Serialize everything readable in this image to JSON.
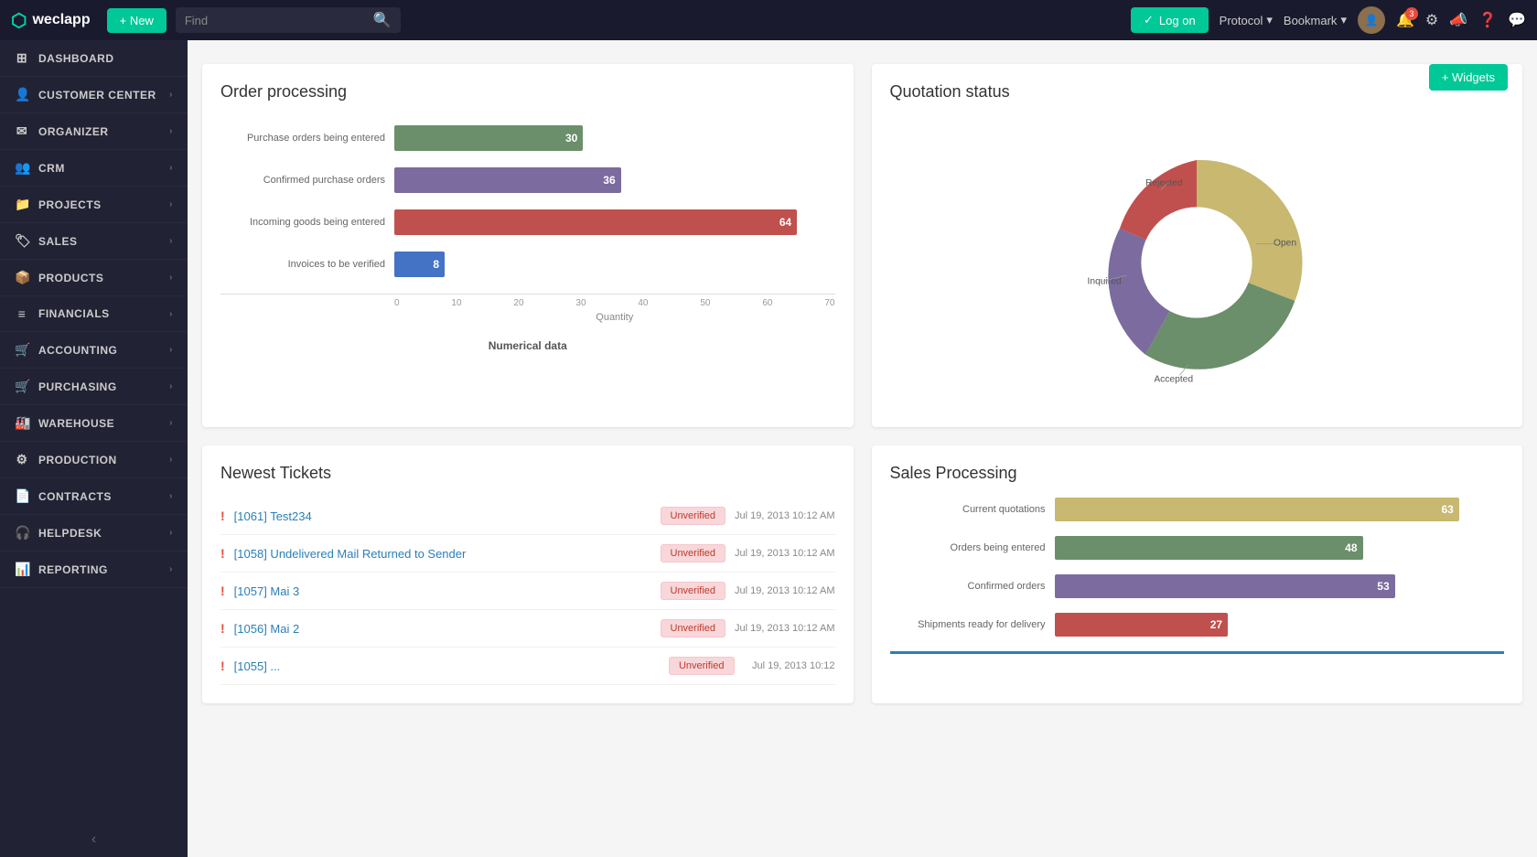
{
  "navbar": {
    "logo_text": "weclapp",
    "new_button": "+ New",
    "search_placeholder": "Find",
    "logon_button": "Log on",
    "protocol_label": "Protocol",
    "bookmark_label": "Bookmark",
    "notification_badge": "3"
  },
  "sidebar": {
    "items": [
      {
        "id": "dashboard",
        "label": "Dashboard",
        "icon": "⊞"
      },
      {
        "id": "customer-center",
        "label": "Customer Center",
        "icon": "👤"
      },
      {
        "id": "organizer",
        "label": "Organizer",
        "icon": "✉"
      },
      {
        "id": "crm",
        "label": "CRM",
        "icon": "👥"
      },
      {
        "id": "projects",
        "label": "Projects",
        "icon": "📁"
      },
      {
        "id": "sales",
        "label": "Sales",
        "icon": "🏷"
      },
      {
        "id": "products",
        "label": "Products",
        "icon": "📦"
      },
      {
        "id": "financials",
        "label": "Financials",
        "icon": "≡"
      },
      {
        "id": "accounting",
        "label": "Accounting",
        "icon": "🛒"
      },
      {
        "id": "purchasing",
        "label": "Purchasing",
        "icon": "🛒"
      },
      {
        "id": "warehouse",
        "label": "Warehouse",
        "icon": "🏭"
      },
      {
        "id": "production",
        "label": "Production",
        "icon": "⚙"
      },
      {
        "id": "contracts",
        "label": "Contracts",
        "icon": "📄"
      },
      {
        "id": "helpdesk",
        "label": "Helpdesk",
        "icon": "🎧"
      },
      {
        "id": "reporting",
        "label": "Reporting",
        "icon": "📊"
      }
    ],
    "collapse_label": "‹"
  },
  "widgets_button": "+ Widgets",
  "order_processing": {
    "title": "Order processing",
    "bars": [
      {
        "label": "Purchase orders being entered",
        "value": 30,
        "color": "#6b8e6b",
        "max_pct": 43
      },
      {
        "label": "Confirmed purchase orders",
        "value": 36,
        "color": "#7b6b9e",
        "max_pct": 52
      },
      {
        "label": "Incoming goods being entered",
        "value": 64,
        "color": "#c0504d",
        "max_pct": 92
      },
      {
        "label": "Invoices to be verified",
        "value": 8,
        "color": "#4472c4",
        "max_pct": 11
      }
    ],
    "axis_labels": [
      "0",
      "10",
      "20",
      "30",
      "40",
      "50",
      "60",
      "70"
    ],
    "axis_title": "Quantity",
    "footer": "Numerical data"
  },
  "quotation_status": {
    "title": "Quotation status",
    "segments": [
      {
        "label": "Open",
        "color": "#c8b870",
        "pct": 35
      },
      {
        "label": "Accepted",
        "color": "#6b8e6b",
        "pct": 30
      },
      {
        "label": "Inquired",
        "color": "#7b6b9e",
        "pct": 20
      },
      {
        "label": "Rejected",
        "color": "#c0504d",
        "pct": 15
      }
    ]
  },
  "newest_tickets": {
    "title": "Newest Tickets",
    "items": [
      {
        "id": "[1061]",
        "name": "Test234",
        "status": "Unverified",
        "date": "Jul 19, 2013 10:12 AM"
      },
      {
        "id": "[1058]",
        "name": "Undelivered Mail Returned to Sender",
        "status": "Unverified",
        "date": "Jul 19, 2013 10:12 AM"
      },
      {
        "id": "[1057]",
        "name": "Mai 3",
        "status": "Unverified",
        "date": "Jul 19, 2013 10:12 AM"
      },
      {
        "id": "[1056]",
        "name": "Mai 2",
        "status": "Unverified",
        "date": "Jul 19, 2013 10:12 AM"
      },
      {
        "id": "[1055]",
        "name": "...",
        "status": "Unverified",
        "date": "Jul 19, 2013 10:12"
      }
    ]
  },
  "sales_processing": {
    "title": "Sales Processing",
    "bars": [
      {
        "label": "Current quotations",
        "value": 63,
        "color": "#c8b870",
        "max_pct": 90
      },
      {
        "label": "Orders being entered",
        "value": 48,
        "color": "#6b8e6b",
        "max_pct": 69
      },
      {
        "label": "Confirmed orders",
        "value": 53,
        "color": "#7b6b9e",
        "max_pct": 76
      },
      {
        "label": "Shipments ready for delivery",
        "value": 27,
        "color": "#c0504d",
        "max_pct": 39
      }
    ]
  }
}
